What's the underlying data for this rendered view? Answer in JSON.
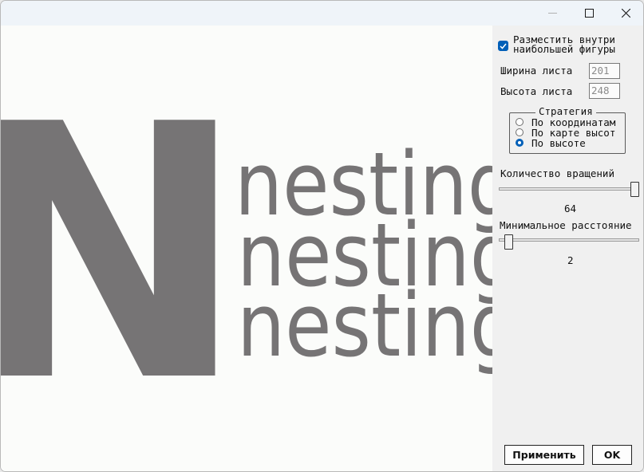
{
  "window": {
    "minimize_icon": "minimize-icon",
    "maximize_icon": "maximize-icon",
    "close_icon": "close-icon"
  },
  "canvas": {
    "big_letter": "N",
    "words": [
      "nesting",
      "nesting",
      "nesting"
    ],
    "fill_color": "#767475"
  },
  "panel": {
    "place_inside_line1": "Разместить внутри",
    "place_inside_line2": "наибольшей фигуры",
    "place_inside_checked": true,
    "sheet_width_label": "Ширина листа",
    "sheet_width_value": "201",
    "sheet_height_label": "Высота листа",
    "sheet_height_value": "248",
    "strategy": {
      "title": "Стратегия",
      "options": [
        "По координатам",
        "По карте высот",
        "По высоте"
      ],
      "selected": "По высоте"
    },
    "rotations_label": "Количество вращений",
    "rotations_value": "64",
    "min_distance_label": "Минимальное расстояние",
    "min_distance_value": "2",
    "apply_button": "Применить",
    "ok_button": "OK",
    "accent_color": "#005fb8"
  }
}
